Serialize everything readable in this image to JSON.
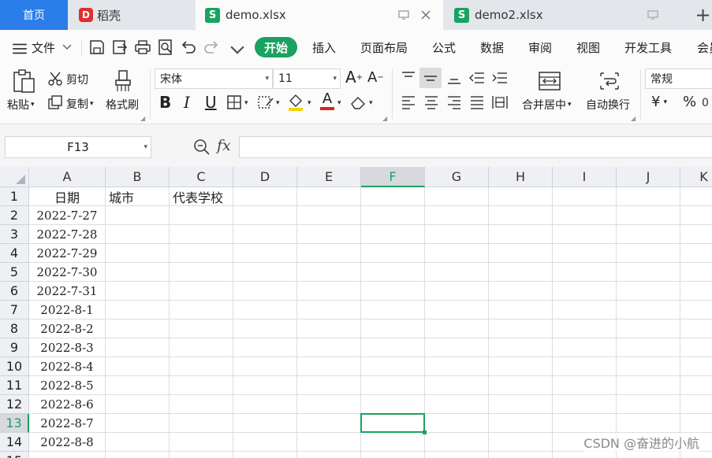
{
  "tabs": {
    "home": "首页",
    "draft": "稻壳",
    "doc1": "demo.xlsx",
    "doc2": "demo2.xlsx",
    "new_tab": "+"
  },
  "menu": {
    "file": "文件",
    "start": "开始",
    "insert": "插入",
    "page_layout": "页面布局",
    "formula": "公式",
    "data": "数据",
    "review": "审阅",
    "view": "视图",
    "developer": "开发工具",
    "member": "会员"
  },
  "ribbon": {
    "paste": "粘贴",
    "cut": "剪切",
    "copy": "复制",
    "format_painter": "格式刷",
    "font_name": "宋体",
    "font_size": "11",
    "merge_center": "合并居中",
    "wrap_text": "自动换行",
    "number_format": "常规",
    "currency_symbol": "¥",
    "percent_symbol": "%",
    "bold": "B",
    "italic": "I",
    "underline": "U",
    "font_color_letter": "A"
  },
  "formula_bar": {
    "name_box": "F13",
    "fx": "fx",
    "value": ""
  },
  "grid": {
    "columns": [
      "A",
      "B",
      "C",
      "D",
      "E",
      "F",
      "G",
      "H",
      "I",
      "J",
      "K"
    ],
    "rows": [
      "1",
      "2",
      "3",
      "4",
      "5",
      "6",
      "7",
      "8",
      "9",
      "10",
      "11",
      "12",
      "13",
      "14",
      "15"
    ],
    "active_column": "F",
    "active_row": "13",
    "header_cells": [
      "日期",
      "城市",
      "代表学校"
    ],
    "dates": [
      "2022-7-27",
      "2022-7-28",
      "2022-7-29",
      "2022-7-30",
      "2022-7-31",
      "2022-8-1",
      "2022-8-2",
      "2022-8-3",
      "2022-8-4",
      "2022-8-5",
      "2022-8-6",
      "2022-8-7",
      "2022-8-8"
    ]
  },
  "watermark": "CSDN @奋进的小航",
  "colors": {
    "accent_green": "#1aa260",
    "home_tab_blue": "#2b7de9",
    "draft_logo_red": "#e02f2f"
  },
  "icons": [
    "menu-icon",
    "save-icon",
    "export-icon",
    "print-icon",
    "preview-icon",
    "undo-icon",
    "redo-icon",
    "scissors-icon",
    "paste-icon",
    "brush-icon",
    "zoom-icon",
    "close-icon",
    "monitor-icon"
  ]
}
